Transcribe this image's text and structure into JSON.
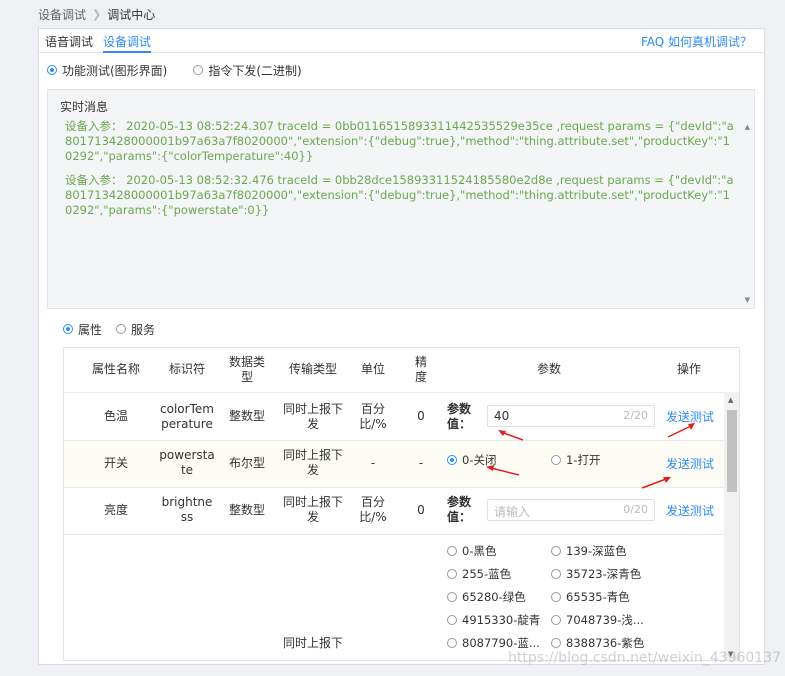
{
  "breadcrumb": {
    "parent": "设备调试",
    "current": "调试中心"
  },
  "tabs": [
    {
      "label": "语音调试"
    },
    {
      "label": "设备调试"
    }
  ],
  "faq_link": "FAQ  如何真机调试？",
  "mode": {
    "option1": "功能测试(图形界面)",
    "option2": "指令下发(二进制)"
  },
  "log": {
    "title": "实时消息",
    "entries": [
      "设备入参： 2020-05-13 08:52:24.307 traceId = 0bb011651589331144253552​9e35ce ,request params = {\"devId\":\"a801713428000001b97a63a7f8020000\",\"extension\":{\"debug\":true},\"method\":\"thing.attribute.set\",\"productKey\":\"10292\",\"params\":{\"colorTemperature\":40}}",
      "设备入参： 2020-05-13 08:52:32.476 traceId = 0bb28dce158933115241855​80e2d8e ,request params = {\"devId\":\"a801713428000001b97a63a7f8020000\",\"extension\":{\"debug\":true},\"method\":\"thing.attribute.set\",\"productKey\":\"10292\",\"params\":{\"powerstate\":0}}"
    ]
  },
  "type_select": {
    "option1": "属性",
    "option2": "服务"
  },
  "table": {
    "headers": [
      "属性名称",
      "标识符",
      "数据类型",
      "传输类型",
      "单位",
      "精度",
      "参数",
      "操作"
    ],
    "rows": [
      {
        "name": "色温",
        "identifier": "colorTemperature",
        "datatype": "整数型",
        "transfer": "同时上报下发",
        "unit": "百分比/%",
        "precision": "0",
        "param_label": "参数值：",
        "value": "40",
        "count": "2/20",
        "action": "发送测试"
      },
      {
        "name": "开关",
        "identifier": "powerstate",
        "datatype": "布尔型",
        "transfer": "同时上报下发",
        "unit": "-",
        "precision": "-",
        "opt_off": "0-关闭",
        "opt_on": "1-打开",
        "action": "发送测试"
      },
      {
        "name": "亮度",
        "identifier": "brightness",
        "datatype": "整数型",
        "transfer": "同时上报下发",
        "unit": "百分比/%",
        "precision": "0",
        "param_label": "参数值：",
        "placeholder": "请输入",
        "count": "0/20",
        "action": "发送测试"
      },
      {
        "transfer": "同时上报下",
        "colors": [
          "0-黑色",
          "139-深蓝色",
          "255-蓝色",
          "35723-深青色",
          "65280-绿色",
          "65535-青色",
          "4915330-靛青",
          "7048739-浅...",
          "8087790-蓝...",
          "8388736-紫色"
        ]
      }
    ]
  },
  "watermark": "https://blog.csdn.net/weixin_43960137"
}
